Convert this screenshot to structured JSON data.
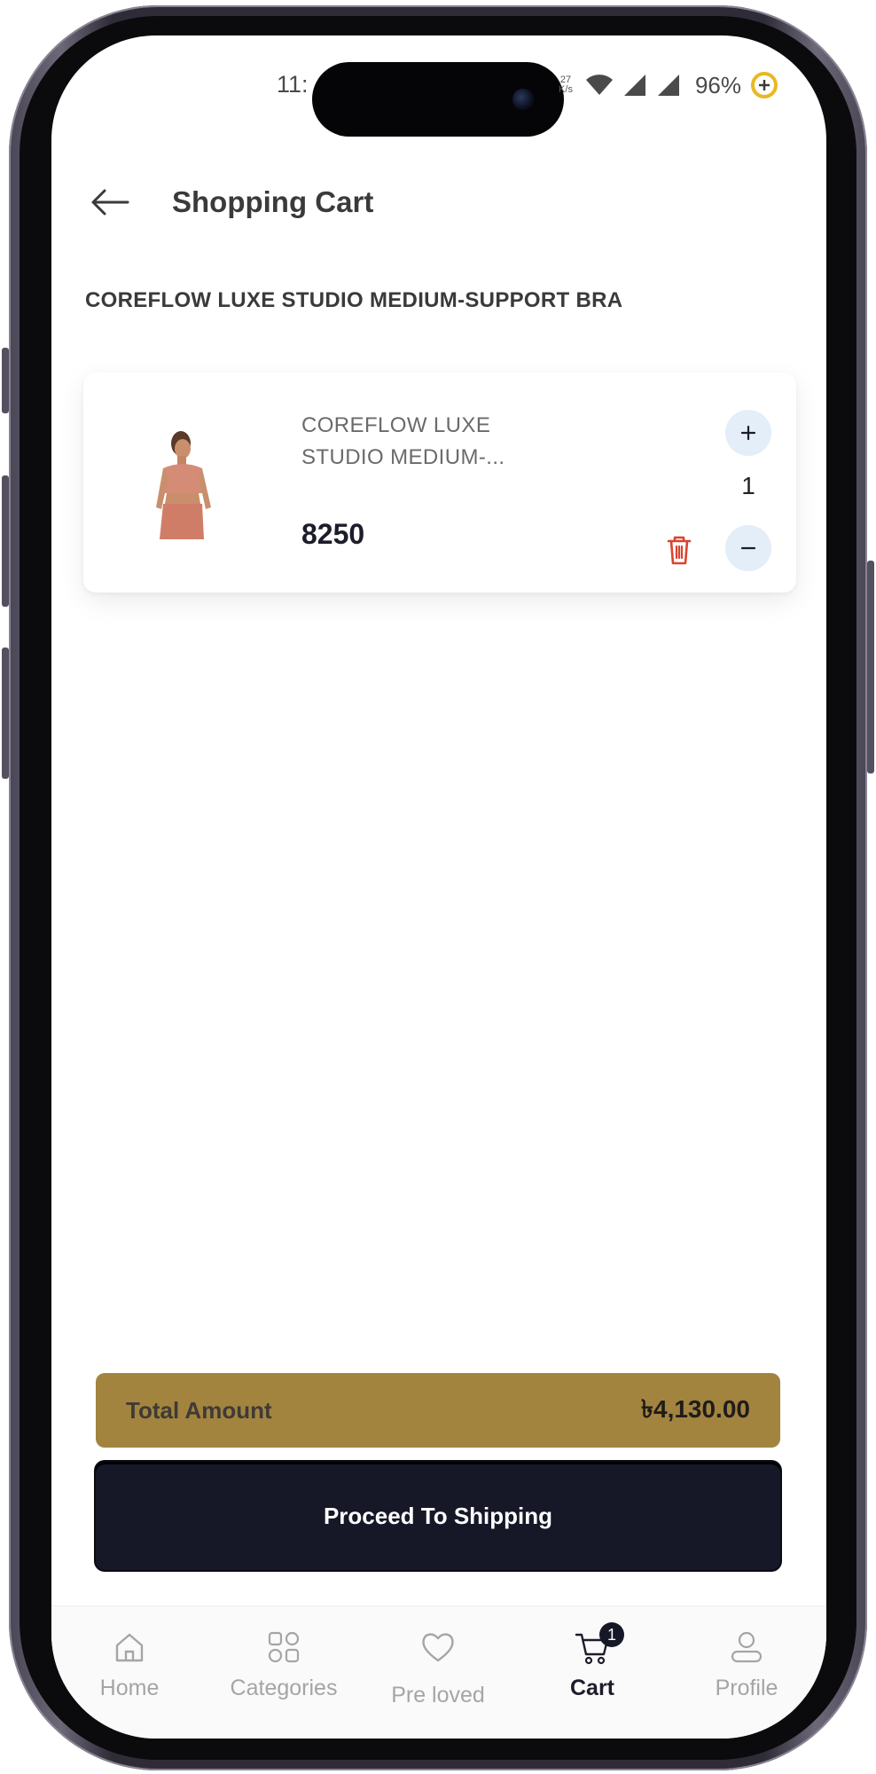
{
  "status_bar": {
    "time": "11:",
    "network_speed": "27",
    "network_unit": "K/s",
    "battery": "96%"
  },
  "header": {
    "back_icon": "arrow-left-icon",
    "title": "Shopping Cart"
  },
  "product_heading": "COREFLOW LUXE STUDIO MEDIUM-SUPPORT BRA",
  "cart": {
    "items": [
      {
        "name": "COREFLOW LUXE STUDIO MEDIUM-...",
        "price": "8250",
        "quantity": "1",
        "increase_icon": "plus-icon",
        "decrease_icon": "minus-icon",
        "delete_icon": "trash-icon"
      }
    ]
  },
  "summary": {
    "total_label": "Total Amount",
    "total_value": "৳4,130.00",
    "proceed_label": "Proceed To Shipping"
  },
  "bottom_nav": {
    "items": [
      {
        "label": "Home",
        "icon": "home-icon"
      },
      {
        "label": "Categories",
        "icon": "grid-icon"
      },
      {
        "label": "Pre loved",
        "icon": "heart-icon"
      },
      {
        "label": "Cart",
        "icon": "cart-icon",
        "badge": "1",
        "active": true
      },
      {
        "label": "Profile",
        "icon": "user-icon"
      }
    ]
  },
  "colors": {
    "accent_gold": "#a2843f",
    "primary_dark": "#161727",
    "delete_red": "#d9452f",
    "qty_button_bg": "#e3eef8"
  }
}
